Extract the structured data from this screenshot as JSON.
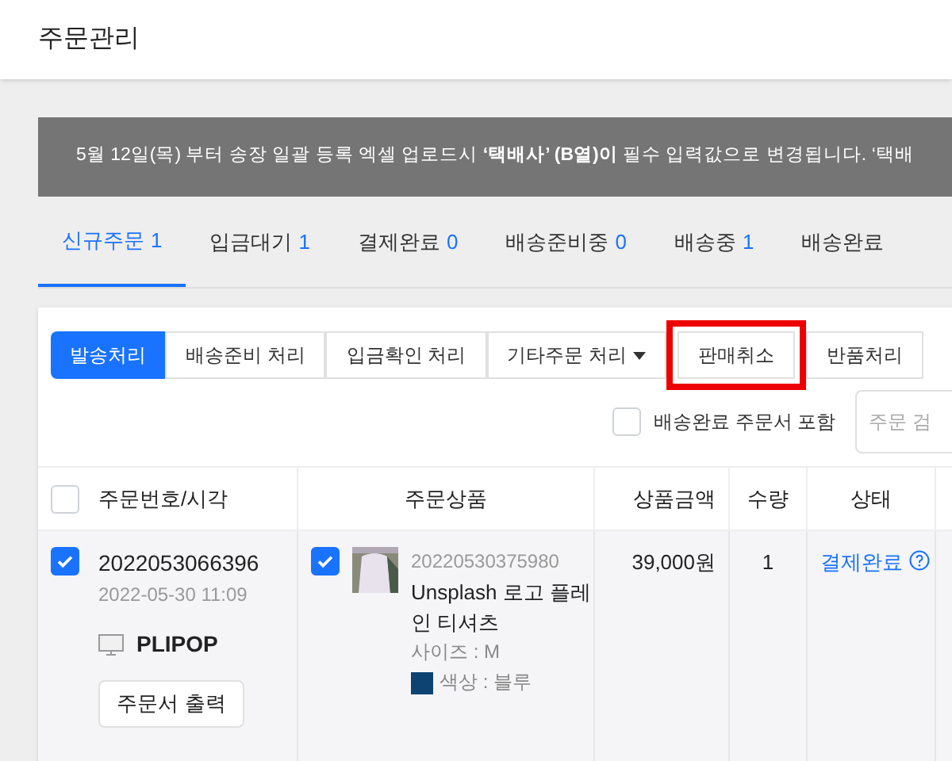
{
  "header": {
    "title": "주문관리"
  },
  "notice": {
    "text": "5월 12일(목) 부터 송장 일괄 등록 엑셀 업로드시 **‘택배사’ (B열)이** 필수 입력값으로 변경됩니다. ‘택배"
  },
  "tabs": [
    {
      "label": "신규주문",
      "count": "1",
      "selected": true
    },
    {
      "label": "입금대기",
      "count": "1",
      "selected": false
    },
    {
      "label": "결제완료",
      "count": "0",
      "selected": false
    },
    {
      "label": "배송준비중",
      "count": "0",
      "selected": false
    },
    {
      "label": "배송중",
      "count": "1",
      "selected": false
    },
    {
      "label": "배송완료",
      "selected": false
    }
  ],
  "actions": [
    {
      "label": "발송처리",
      "kind": "primary",
      "highlighted": false
    },
    {
      "label": "배송준비 처리",
      "kind": "normal",
      "highlighted": false
    },
    {
      "label": "입금확인 처리",
      "kind": "normal",
      "highlighted": false
    },
    {
      "label": "기타주문 처리",
      "kind": "dropdown",
      "highlighted": false
    },
    {
      "label": "판매취소",
      "kind": "normal",
      "highlighted": true
    },
    {
      "label": "반품처리",
      "kind": "normal",
      "highlighted": false
    }
  ],
  "filter": {
    "include_delivered": {
      "label": "배송완료 주문서 포함",
      "checked": false
    },
    "search": {
      "placeholder": "주문 검"
    }
  },
  "table": {
    "select_all": false,
    "columns": [
      "주문번호/시각",
      "주문상품",
      "상품금액",
      "수량",
      "상태"
    ],
    "rows": [
      {
        "selected": true,
        "order_no": "2022053066396",
        "time": "2022-05-30 11:09",
        "channel": "PLIPOP",
        "print_button": "주문서 출력",
        "product": {
          "selected": true,
          "code": "20220530375980",
          "name": "Unsplash 로고 플레인 티셔츠",
          "options": [
            {
              "text": "사이즈 : M"
            },
            {
              "text": "색상 : 블루",
              "color": "#0d4373"
            }
          ]
        },
        "price": "39,000원",
        "quantity": "1",
        "status": "결제완료"
      }
    ]
  }
}
